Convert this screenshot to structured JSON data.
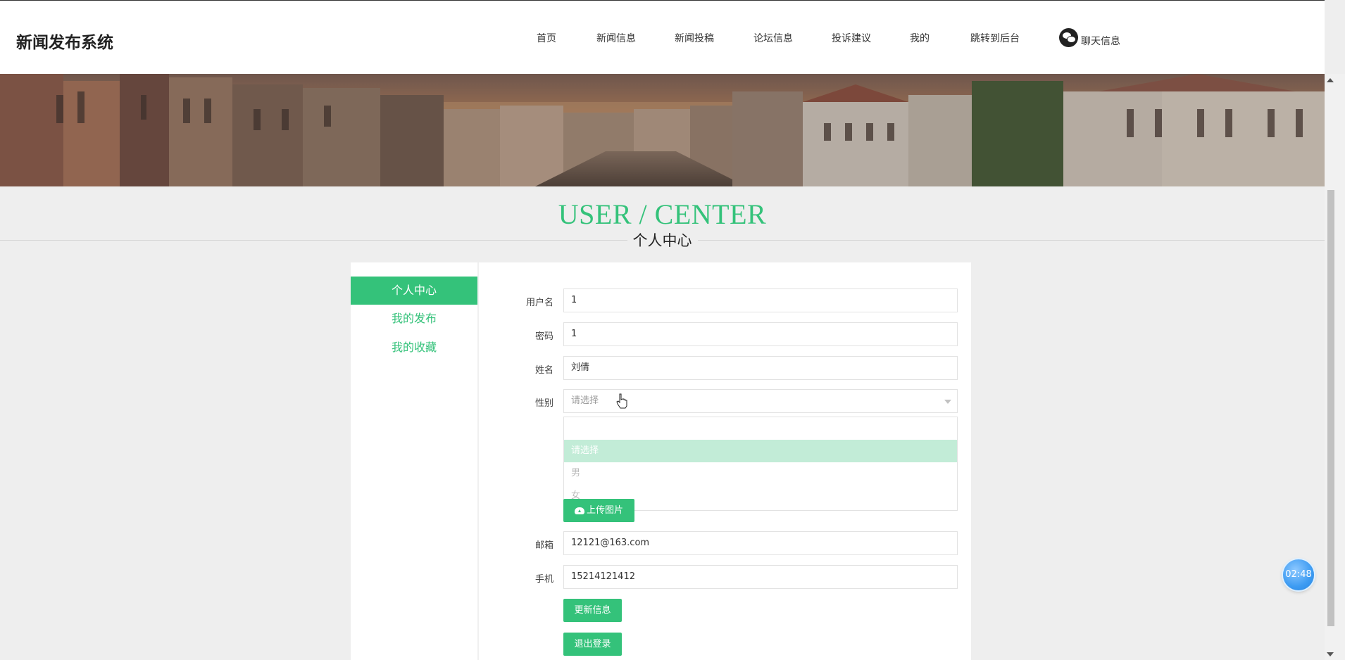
{
  "header": {
    "site_title": "新闻发布系统",
    "nav": [
      {
        "label": "首页"
      },
      {
        "label": "新闻信息"
      },
      {
        "label": "新闻投稿"
      },
      {
        "label": "论坛信息"
      },
      {
        "label": "投诉建议"
      },
      {
        "label": "我的"
      },
      {
        "label": "跳转到后台"
      }
    ],
    "chat_label": "聊天信息",
    "chat_icon": "wechat-icon"
  },
  "section": {
    "title_en": "USER / CENTER",
    "title_cn": "个人中心"
  },
  "sidebar": {
    "items": [
      {
        "label": "个人中心",
        "active": true
      },
      {
        "label": "我的发布",
        "active": false
      },
      {
        "label": "我的收藏",
        "active": false
      }
    ]
  },
  "form": {
    "username": {
      "label": "用户名",
      "value": "1"
    },
    "password": {
      "label": "密码",
      "value": "1"
    },
    "name": {
      "label": "姓名",
      "value": "刘倩"
    },
    "gender": {
      "label": "性别",
      "placeholder": "请选择",
      "options": [
        "请选择",
        "男",
        "女"
      ],
      "selected": "请选择"
    },
    "upload_label": "上传图片",
    "email": {
      "label": "邮箱",
      "value": "12121@163.com"
    },
    "phone": {
      "label": "手机",
      "value": "15214121412"
    },
    "update_button": "更新信息",
    "logout_button": "退出登录"
  },
  "timer": "02:48",
  "colors": {
    "accent": "#34c27a",
    "accent_light": "#c2ecd7",
    "background": "#eeeeee"
  }
}
